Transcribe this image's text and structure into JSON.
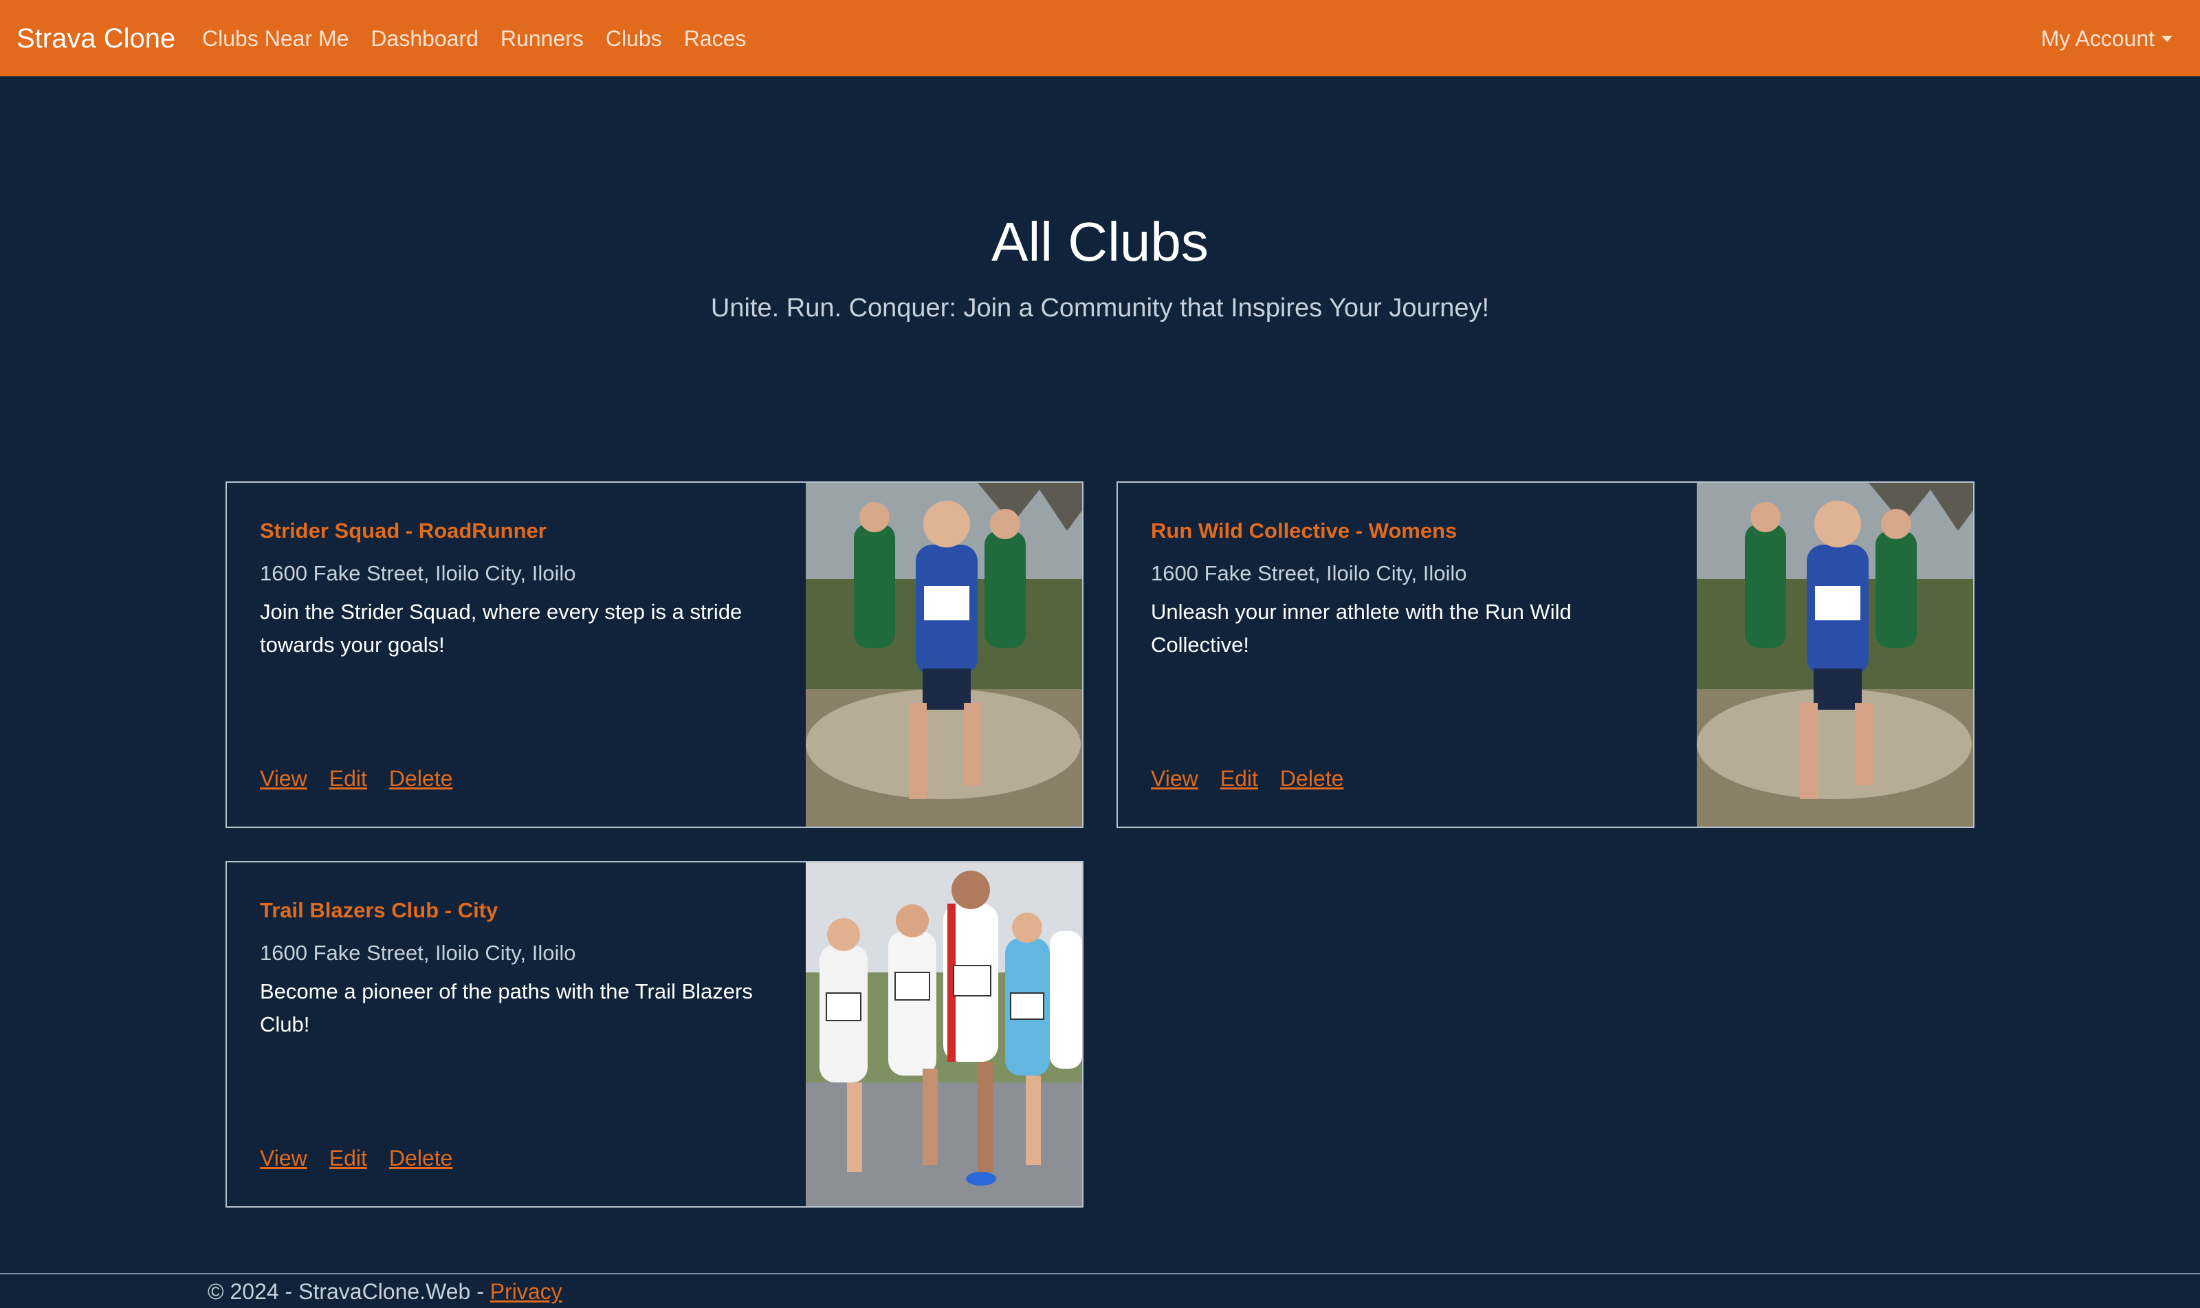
{
  "nav": {
    "brand": "Strava Clone",
    "links": [
      "Clubs Near Me",
      "Dashboard",
      "Runners",
      "Clubs",
      "Races"
    ],
    "account": "My Account"
  },
  "hero": {
    "title": "All Clubs",
    "subtitle": "Unite. Run. Conquer: Join a Community that Inspires Your Journey!"
  },
  "clubs": [
    {
      "title": "Strider Squad - RoadRunner",
      "address": "1600 Fake Street, Iloilo City, Iloilo",
      "description": "Join the Strider Squad, where every step is a stride towards your goals!",
      "actions": [
        "View",
        "Edit",
        "Delete"
      ],
      "photo": "cross-country-runners-splashing"
    },
    {
      "title": "Run Wild Collective - Womens",
      "address": "1600 Fake Street, Iloilo City, Iloilo",
      "description": "Unleash your inner athlete with the Run Wild Collective!",
      "actions": [
        "View",
        "Edit",
        "Delete"
      ],
      "photo": "cross-country-runners-splashing"
    },
    {
      "title": "Trail Blazers Club - City",
      "address": "1600 Fake Street, Iloilo City, Iloilo",
      "description": "Become a pioneer of the paths with the Trail Blazers Club!",
      "actions": [
        "View",
        "Edit",
        "Delete"
      ],
      "photo": "road-race-runners-group"
    }
  ],
  "footer": {
    "text": "© 2024 - StravaClone.Web - ",
    "link": "Privacy"
  },
  "colors": {
    "navbar": "#e16a1d",
    "background": "#10233a",
    "accent": "#e16a1d"
  }
}
